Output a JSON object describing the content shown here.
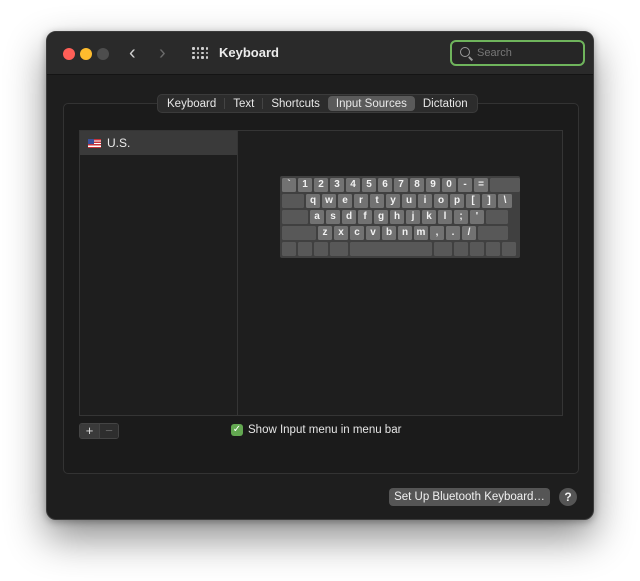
{
  "window": {
    "title": "Keyboard"
  },
  "search": {
    "placeholder": "Search"
  },
  "nav": {
    "back": "‹",
    "forward": "›"
  },
  "tabs": [
    {
      "label": "Keyboard"
    },
    {
      "label": "Text"
    },
    {
      "label": "Shortcuts"
    },
    {
      "label": "Input Sources",
      "active": true
    },
    {
      "label": "Dictation"
    }
  ],
  "sources": [
    {
      "label": "U.S.",
      "flag": "us-flag-icon"
    }
  ],
  "keyboard": {
    "rows": [
      [
        "`",
        "1",
        "2",
        "3",
        "4",
        "5",
        "6",
        "7",
        "8",
        "9",
        "0",
        "-",
        "="
      ],
      [
        "q",
        "w",
        "e",
        "r",
        "t",
        "y",
        "u",
        "i",
        "o",
        "p",
        "[",
        "]",
        "\\"
      ],
      [
        "a",
        "s",
        "d",
        "f",
        "g",
        "h",
        "j",
        "k",
        "l",
        ";",
        "'"
      ],
      [
        "z",
        "x",
        "c",
        "v",
        "b",
        "n",
        "m",
        ",",
        ".",
        "/"
      ]
    ]
  },
  "controls": {
    "add": "+",
    "remove": "−"
  },
  "show_menu": {
    "label": "Show Input menu in menu bar",
    "checked": true
  },
  "bluetooth_button": "Set Up Bluetooth Keyboard…",
  "help": "?",
  "colors": {
    "accent": "#6fb45c",
    "checkbox": "#63a851"
  }
}
